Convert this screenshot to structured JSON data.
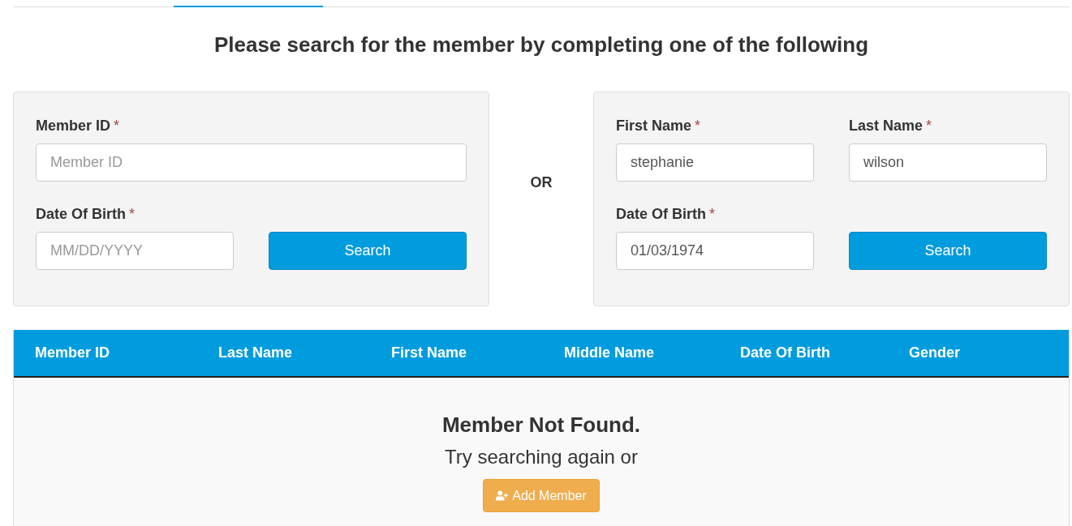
{
  "heading": "Please search for the member by completing one of the following",
  "id_search": {
    "fields": [
      {
        "label": "Member ID",
        "mark": "*",
        "placeholder": "Member ID",
        "wide": true
      },
      {
        "label": "Date Of Birth",
        "mark": "*",
        "placeholder": "MM/DD/YYYY",
        "wide": false
      }
    ],
    "button": "Search"
  },
  "separator": "OR",
  "name_search": {
    "fields": [
      {
        "label": "First Name",
        "mark": "*",
        "value": "stephanie"
      },
      {
        "label": "Last Name",
        "mark": "*",
        "value": "wilson"
      },
      {
        "label": "Date Of Birth",
        "mark": "*",
        "value": "01/03/1974"
      }
    ],
    "button": "Search"
  },
  "table": {
    "columns": [
      "Member ID",
      "Last Name",
      "First Name",
      "Middle Name",
      "Date Of Birth",
      "Gender"
    ],
    "empty": {
      "title": "Member Not Found.",
      "message": "Try searching again or",
      "button": "Add Member"
    }
  }
}
